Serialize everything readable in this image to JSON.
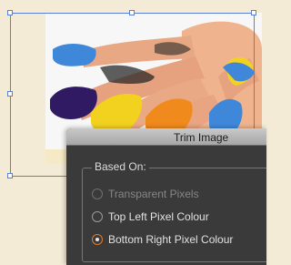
{
  "dialog": {
    "title": "Trim Image",
    "group_label": "Based On:",
    "options": [
      {
        "label": "Transparent Pixels",
        "disabled": true,
        "checked": false
      },
      {
        "label": "Top Left Pixel Colour",
        "disabled": false,
        "checked": false
      },
      {
        "label": "Bottom Right Pixel Colour",
        "disabled": false,
        "checked": true
      }
    ]
  },
  "colors": {
    "canvas_bg": "#f3ebd6",
    "selection": "#5b7fd6",
    "dialog_bg": "#3a3a3a",
    "radio_accent": "#e07b2b"
  },
  "image": {
    "subject": "hand with paint-covered fingertips",
    "paint_colors": [
      "#2f1a63",
      "#f2d21f",
      "#f08a1c",
      "#3f88d9"
    ]
  }
}
